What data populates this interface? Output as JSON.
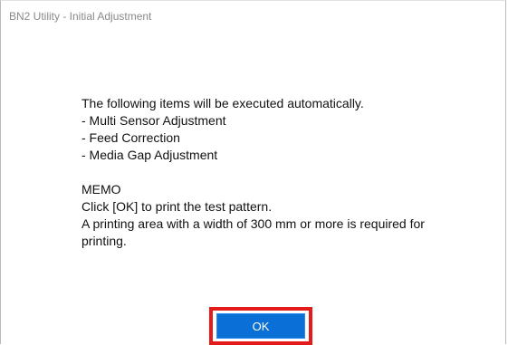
{
  "window": {
    "title": "BN2 Utility - Initial Adjustment"
  },
  "message": {
    "intro": "The following items will be executed automatically.",
    "items": [
      "- Multi Sensor Adjustment",
      "- Feed Correction",
      "- Media Gap Adjustment"
    ],
    "memo_heading": "MEMO",
    "memo_lines": [
      "Click [OK] to print the test pattern.",
      "A printing area with a width of 300 mm or more is required for printing."
    ]
  },
  "buttons": {
    "ok_label": "OK"
  },
  "colors": {
    "primary_button": "#0a6fd6",
    "highlight_border": "#e31b1b"
  }
}
